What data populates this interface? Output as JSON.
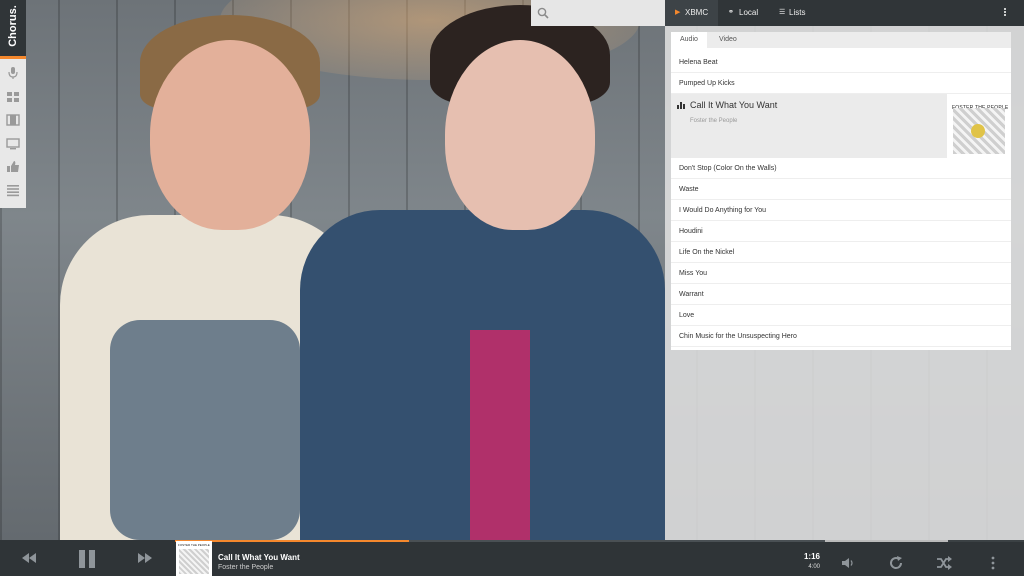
{
  "app": {
    "logo_text": "Chorus."
  },
  "sidebar": {
    "items": [
      {
        "icon": "microphone-icon"
      },
      {
        "icon": "albums-grid-icon"
      },
      {
        "icon": "movies-film-icon"
      },
      {
        "icon": "tv-icon"
      },
      {
        "icon": "thumbs-up-icon"
      },
      {
        "icon": "playlist-icon"
      }
    ]
  },
  "topbar": {
    "search_placeholder": "",
    "tabs": [
      {
        "label": "XBMC",
        "icon": "play-icon",
        "active": true
      },
      {
        "label": "Local",
        "icon": "headphones-icon",
        "active": false
      },
      {
        "label": "Lists",
        "icon": "list-icon",
        "active": false
      }
    ]
  },
  "playlist": {
    "tabs": [
      {
        "label": "Audio"
      },
      {
        "label": "Video"
      }
    ],
    "tracks": [
      {
        "title": "Helena Beat"
      },
      {
        "title": "Pumped Up Kicks"
      },
      {
        "title": "Call It What You Want",
        "artist": "Foster the People",
        "playing": true
      },
      {
        "title": "Don't Stop (Color On the Walls)"
      },
      {
        "title": "Waste"
      },
      {
        "title": "I Would Do Anything for You"
      },
      {
        "title": "Houdini"
      },
      {
        "title": "Life On the Nickel"
      },
      {
        "title": "Miss You"
      },
      {
        "title": "Warrant"
      },
      {
        "title": "Love"
      },
      {
        "title": "Chin Music for the Unsuspecting Hero"
      }
    ],
    "album_art_text": "FOSTER THE PEOPLE"
  },
  "player": {
    "title": "Call It What You Want",
    "artist": "Foster the People",
    "elapsed": "1:16",
    "total": "4:00",
    "progress_fraction": 0.36,
    "volume_fraction": 0.62,
    "accent_color": "#f5882d"
  }
}
